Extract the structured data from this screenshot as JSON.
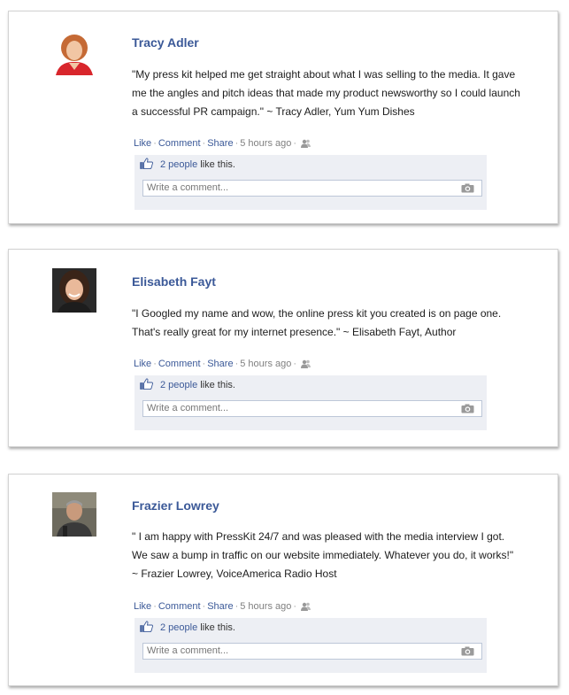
{
  "testimonials": [
    {
      "name": "Tracy Adler",
      "quote": "\"My press kit helped me get straight about what I was selling to the media. It gave me the angles and pitch ideas that made my product newsworthy so I could launch a successful PR campaign.\" ~ Tracy Adler, Yum Yum Dishes",
      "like_label": "Like",
      "comment_label": "Comment",
      "share_label": "Share",
      "time": "5 hours ago",
      "likes_count": "2 people",
      "likes_suffix": "like this.",
      "comment_placeholder": "Write a comment..."
    },
    {
      "name": "Elisabeth Fayt",
      "quote": "\"I Googled my name and wow, the online press kit you created is on page one. That's really great for my internet presence.\" ~ Elisabeth Fayt, Author",
      "like_label": "Like",
      "comment_label": "Comment",
      "share_label": "Share",
      "time": "5 hours ago",
      "likes_count": "2 people",
      "likes_suffix": "like this.",
      "comment_placeholder": "Write a comment..."
    },
    {
      "name": "Frazier Lowrey",
      "quote": "\" I am happy with PressKit 24/7 and was pleased with the media interview I got. We saw a bump in traffic on our website immediately. Whatever you do, it works!\" ~ Frazier Lowrey, VoiceAmerica Radio Host",
      "like_label": "Like",
      "comment_label": "Comment",
      "share_label": "Share",
      "time": "5 hours ago",
      "likes_count": "2 people",
      "likes_suffix": "like this.",
      "comment_placeholder": "Write a comment..."
    }
  ],
  "colors": {
    "link": "#3b5998",
    "panel": "#edeff4",
    "border": "#bdc7d8"
  },
  "icons": [
    "thumbs-up-icon",
    "people-icon",
    "camera-icon"
  ]
}
